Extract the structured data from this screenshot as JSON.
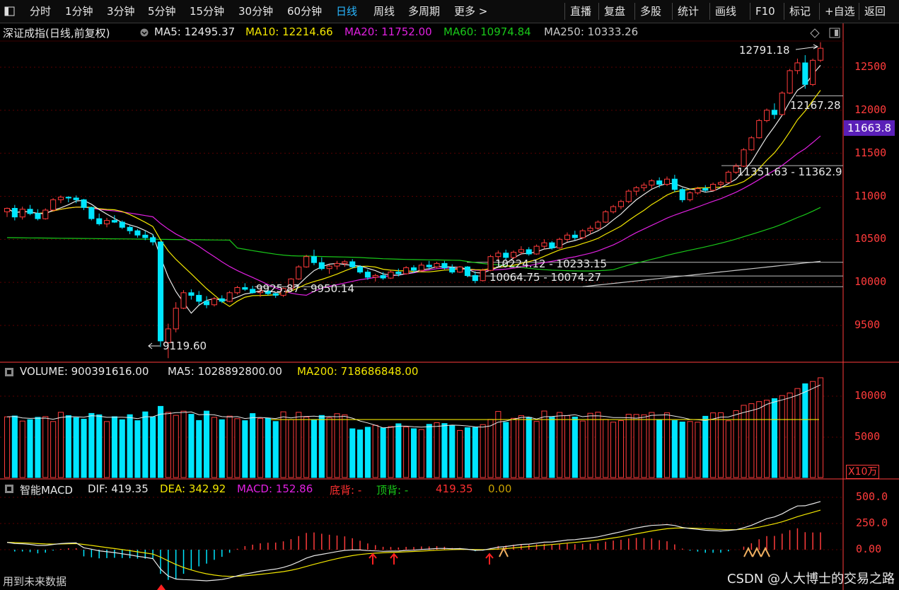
{
  "toolbar": {
    "left_items": [
      "分时",
      "1分钟",
      "3分钟",
      "5分钟",
      "15分钟",
      "30分钟",
      "60分钟",
      "日线",
      "周线",
      "多周期",
      "更多 >"
    ],
    "active": "日线",
    "right_items": [
      "直播",
      "复盘",
      "多股",
      "统计",
      "画线",
      "F10",
      "标记",
      "+自选",
      "返回"
    ]
  },
  "main": {
    "title": "深证成指(日线,前复权)",
    "ma_legend": [
      {
        "label": "MA5: 12495.37",
        "color": "#e8e8e8"
      },
      {
        "label": "MA10: 12214.66",
        "color": "#f2e600"
      },
      {
        "label": "MA20: 11752.00",
        "color": "#e020e0"
      },
      {
        "label": "MA60: 10974.84",
        "color": "#19c819"
      },
      {
        "label": "MA250: 10333.26",
        "color": "#c8c8c8"
      }
    ],
    "current_price_tag": "11663.8"
  },
  "volume": {
    "legend": [
      {
        "label": "VOLUME: 900391616.00",
        "color": "#e8e8e8"
      },
      {
        "label": "MA5: 1028892800.00",
        "color": "#e8e8e8"
      },
      {
        "label": "MA200: 718686848.00",
        "color": "#f2e600"
      }
    ],
    "unit": "X10万"
  },
  "macd": {
    "legend": [
      {
        "label": "智能MACD",
        "color": "#e8e8e8"
      },
      {
        "label": "DIF: 419.35",
        "color": "#e8e8e8"
      },
      {
        "label": "DEA: 342.92",
        "color": "#f2e600"
      },
      {
        "label": "MACD: 152.86",
        "color": "#e020e0"
      },
      {
        "label": "底背: -",
        "color": "#ff3030"
      },
      {
        "label": "顶背: -",
        "color": "#19c819"
      },
      {
        "label": "419.35",
        "color": "#ff3030"
      },
      {
        "label": "0.00",
        "color": "#c8a000"
      }
    ]
  },
  "footer": {
    "future_data": "用到未来数据",
    "watermark": "CSDN @人大博士的交易之路"
  },
  "chart_data": [
    {
      "type": "candlestick",
      "title": "深证成指(日线,前复权)",
      "y_ticks": [
        "12500",
        "12000",
        "11500",
        "11000",
        "10500",
        "10000",
        "9500"
      ],
      "ylim": [
        9000,
        12900
      ],
      "colors": {
        "up": "#ff3b3b",
        "down": "#00e6ff"
      },
      "annotations": [
        "12791.18",
        "12167.28",
        "11351.63 - 11362.9",
        "10224.12 - 10233.15",
        "10064.75 - 10074.27",
        "9925.87 - 9950.14",
        "9119.60"
      ],
      "support_lines": [
        12167.28,
        11357.0,
        10233.15,
        10074.27
      ],
      "candles": [
        {
          "o": 10820,
          "h": 10870,
          "l": 10760,
          "c": 10860
        },
        {
          "o": 10860,
          "h": 10900,
          "l": 10720,
          "c": 10760
        },
        {
          "o": 10760,
          "h": 10880,
          "l": 10730,
          "c": 10850
        },
        {
          "o": 10850,
          "h": 10900,
          "l": 10780,
          "c": 10800
        },
        {
          "o": 10800,
          "h": 10850,
          "l": 10720,
          "c": 10740
        },
        {
          "o": 10740,
          "h": 10860,
          "l": 10730,
          "c": 10840
        },
        {
          "o": 10840,
          "h": 10980,
          "l": 10830,
          "c": 10960
        },
        {
          "o": 10960,
          "h": 11010,
          "l": 10920,
          "c": 10990
        },
        {
          "o": 10990,
          "h": 11000,
          "l": 10930,
          "c": 10980
        },
        {
          "o": 10980,
          "h": 11010,
          "l": 10920,
          "c": 10960
        },
        {
          "o": 10960,
          "h": 10970,
          "l": 10840,
          "c": 10870
        },
        {
          "o": 10870,
          "h": 10880,
          "l": 10720,
          "c": 10740
        },
        {
          "o": 10740,
          "h": 10800,
          "l": 10660,
          "c": 10680
        },
        {
          "o": 10680,
          "h": 10750,
          "l": 10640,
          "c": 10720
        },
        {
          "o": 10720,
          "h": 10780,
          "l": 10690,
          "c": 10700
        },
        {
          "o": 10700,
          "h": 10720,
          "l": 10620,
          "c": 10640
        },
        {
          "o": 10640,
          "h": 10660,
          "l": 10560,
          "c": 10600
        },
        {
          "o": 10600,
          "h": 10620,
          "l": 10520,
          "c": 10550
        },
        {
          "o": 10550,
          "h": 10600,
          "l": 10490,
          "c": 10520
        },
        {
          "o": 10520,
          "h": 10560,
          "l": 10430,
          "c": 10470
        },
        {
          "o": 10470,
          "h": 10480,
          "l": 9250,
          "c": 9320
        },
        {
          "o": 9300,
          "h": 9520,
          "l": 9119.6,
          "c": 9460
        },
        {
          "o": 9460,
          "h": 9770,
          "l": 9420,
          "c": 9700
        },
        {
          "o": 9700,
          "h": 9910,
          "l": 9690,
          "c": 9880
        },
        {
          "o": 9880,
          "h": 9920,
          "l": 9800,
          "c": 9850
        },
        {
          "o": 9850,
          "h": 9900,
          "l": 9740,
          "c": 9780
        },
        {
          "o": 9780,
          "h": 9840,
          "l": 9700,
          "c": 9740
        },
        {
          "o": 9740,
          "h": 9830,
          "l": 9720,
          "c": 9810
        },
        {
          "o": 9810,
          "h": 9850,
          "l": 9760,
          "c": 9780
        },
        {
          "o": 9780,
          "h": 9900,
          "l": 9770,
          "c": 9880
        },
        {
          "o": 9880,
          "h": 9960,
          "l": 9860,
          "c": 9940
        },
        {
          "o": 9940,
          "h": 9990,
          "l": 9900,
          "c": 9920
        },
        {
          "o": 9920,
          "h": 9960,
          "l": 9870,
          "c": 9880
        },
        {
          "o": 9880,
          "h": 9930,
          "l": 9830,
          "c": 9900
        },
        {
          "o": 9900,
          "h": 9960,
          "l": 9850,
          "c": 9870
        },
        {
          "o": 9870,
          "h": 9880,
          "l": 9820,
          "c": 9850
        },
        {
          "o": 9850,
          "h": 9940,
          "l": 9830,
          "c": 9930
        },
        {
          "o": 9930,
          "h": 10050,
          "l": 9920,
          "c": 10040
        },
        {
          "o": 10040,
          "h": 10200,
          "l": 10030,
          "c": 10180
        },
        {
          "o": 10180,
          "h": 10320,
          "l": 10170,
          "c": 10300
        },
        {
          "o": 10300,
          "h": 10380,
          "l": 10200,
          "c": 10230
        },
        {
          "o": 10230,
          "h": 10290,
          "l": 10140,
          "c": 10160
        },
        {
          "o": 10160,
          "h": 10210,
          "l": 10100,
          "c": 10190
        },
        {
          "o": 10190,
          "h": 10250,
          "l": 10150,
          "c": 10220
        },
        {
          "o": 10220,
          "h": 10260,
          "l": 10180,
          "c": 10240
        },
        {
          "o": 10240,
          "h": 10270,
          "l": 10160,
          "c": 10180
        },
        {
          "o": 10180,
          "h": 10200,
          "l": 10100,
          "c": 10120
        },
        {
          "o": 10120,
          "h": 10150,
          "l": 10030,
          "c": 10060
        },
        {
          "o": 10060,
          "h": 10100,
          "l": 10010,
          "c": 10080
        },
        {
          "o": 10080,
          "h": 10120,
          "l": 10030,
          "c": 10050
        },
        {
          "o": 10050,
          "h": 10140,
          "l": 10040,
          "c": 10120
        },
        {
          "o": 10120,
          "h": 10160,
          "l": 10070,
          "c": 10100
        },
        {
          "o": 10100,
          "h": 10190,
          "l": 10090,
          "c": 10170
        },
        {
          "o": 10170,
          "h": 10200,
          "l": 10110,
          "c": 10140
        },
        {
          "o": 10140,
          "h": 10230,
          "l": 10130,
          "c": 10200
        },
        {
          "o": 10200,
          "h": 10250,
          "l": 10150,
          "c": 10180
        },
        {
          "o": 10180,
          "h": 10240,
          "l": 10160,
          "c": 10220
        },
        {
          "o": 10220,
          "h": 10250,
          "l": 10150,
          "c": 10170
        },
        {
          "o": 10170,
          "h": 10210,
          "l": 10100,
          "c": 10120
        },
        {
          "o": 10120,
          "h": 10190,
          "l": 10110,
          "c": 10180
        },
        {
          "o": 10180,
          "h": 10190,
          "l": 10060,
          "c": 10080
        },
        {
          "o": 10080,
          "h": 10130,
          "l": 9990,
          "c": 10020
        },
        {
          "o": 10020,
          "h": 10160,
          "l": 10010,
          "c": 10140
        },
        {
          "o": 10140,
          "h": 10320,
          "l": 10130,
          "c": 10300
        },
        {
          "o": 10300,
          "h": 10370,
          "l": 10250,
          "c": 10340
        },
        {
          "o": 10340,
          "h": 10380,
          "l": 10260,
          "c": 10290
        },
        {
          "o": 10290,
          "h": 10370,
          "l": 10270,
          "c": 10350
        },
        {
          "o": 10350,
          "h": 10420,
          "l": 10320,
          "c": 10380
        },
        {
          "o": 10380,
          "h": 10410,
          "l": 10310,
          "c": 10330
        },
        {
          "o": 10330,
          "h": 10440,
          "l": 10320,
          "c": 10420
        },
        {
          "o": 10420,
          "h": 10500,
          "l": 10390,
          "c": 10460
        },
        {
          "o": 10460,
          "h": 10480,
          "l": 10380,
          "c": 10400
        },
        {
          "o": 10400,
          "h": 10520,
          "l": 10390,
          "c": 10500
        },
        {
          "o": 10500,
          "h": 10580,
          "l": 10470,
          "c": 10550
        },
        {
          "o": 10550,
          "h": 10600,
          "l": 10490,
          "c": 10520
        },
        {
          "o": 10520,
          "h": 10620,
          "l": 10510,
          "c": 10600
        },
        {
          "o": 10600,
          "h": 10660,
          "l": 10560,
          "c": 10630
        },
        {
          "o": 10630,
          "h": 10720,
          "l": 10610,
          "c": 10700
        },
        {
          "o": 10700,
          "h": 10840,
          "l": 10690,
          "c": 10820
        },
        {
          "o": 10820,
          "h": 10900,
          "l": 10800,
          "c": 10880
        },
        {
          "o": 10880,
          "h": 10960,
          "l": 10850,
          "c": 10940
        },
        {
          "o": 10940,
          "h": 11080,
          "l": 10920,
          "c": 11060
        },
        {
          "o": 11060,
          "h": 11120,
          "l": 11010,
          "c": 11100
        },
        {
          "o": 11100,
          "h": 11160,
          "l": 11060,
          "c": 11130
        },
        {
          "o": 11130,
          "h": 11200,
          "l": 11090,
          "c": 11180
        },
        {
          "o": 11180,
          "h": 11220,
          "l": 11100,
          "c": 11140
        },
        {
          "o": 11140,
          "h": 11230,
          "l": 11120,
          "c": 11200
        },
        {
          "o": 11200,
          "h": 11250,
          "l": 11050,
          "c": 11080
        },
        {
          "o": 11080,
          "h": 11100,
          "l": 10930,
          "c": 10960
        },
        {
          "o": 10960,
          "h": 11060,
          "l": 10940,
          "c": 11040
        },
        {
          "o": 11040,
          "h": 11110,
          "l": 11020,
          "c": 11090
        },
        {
          "o": 11090,
          "h": 11130,
          "l": 11050,
          "c": 11070
        },
        {
          "o": 11070,
          "h": 11160,
          "l": 11060,
          "c": 11140
        },
        {
          "o": 11140,
          "h": 11180,
          "l": 11100,
          "c": 11160
        },
        {
          "o": 11160,
          "h": 11300,
          "l": 11150,
          "c": 11280
        },
        {
          "o": 11280,
          "h": 11380,
          "l": 11260,
          "c": 11350
        },
        {
          "o": 11350,
          "h": 11560,
          "l": 11340,
          "c": 11540
        },
        {
          "o": 11540,
          "h": 11700,
          "l": 11530,
          "c": 11680
        },
        {
          "o": 11680,
          "h": 11900,
          "l": 11670,
          "c": 11880
        },
        {
          "o": 11880,
          "h": 12020,
          "l": 11860,
          "c": 12000
        },
        {
          "o": 12000,
          "h": 12080,
          "l": 11900,
          "c": 11950
        },
        {
          "o": 11950,
          "h": 12220,
          "l": 11940,
          "c": 12200
        },
        {
          "o": 12200,
          "h": 12480,
          "l": 12190,
          "c": 12460
        },
        {
          "o": 12460,
          "h": 12600,
          "l": 12420,
          "c": 12550
        },
        {
          "o": 12550,
          "h": 12640,
          "l": 12250,
          "c": 12300
        },
        {
          "o": 12300,
          "h": 12600,
          "l": 12280,
          "c": 12580
        },
        {
          "o": 12580,
          "h": 12791.18,
          "l": 12560,
          "c": 12720
        }
      ]
    },
    {
      "type": "bar",
      "title": "VOLUME",
      "y_ticks": [
        "10000",
        "5000"
      ],
      "ylim": [
        0,
        12000
      ]
    },
    {
      "type": "bar",
      "title": "智能MACD",
      "y_ticks": [
        "500.0",
        "250.0",
        "0.00"
      ],
      "ylim": [
        -300,
        650
      ]
    }
  ]
}
